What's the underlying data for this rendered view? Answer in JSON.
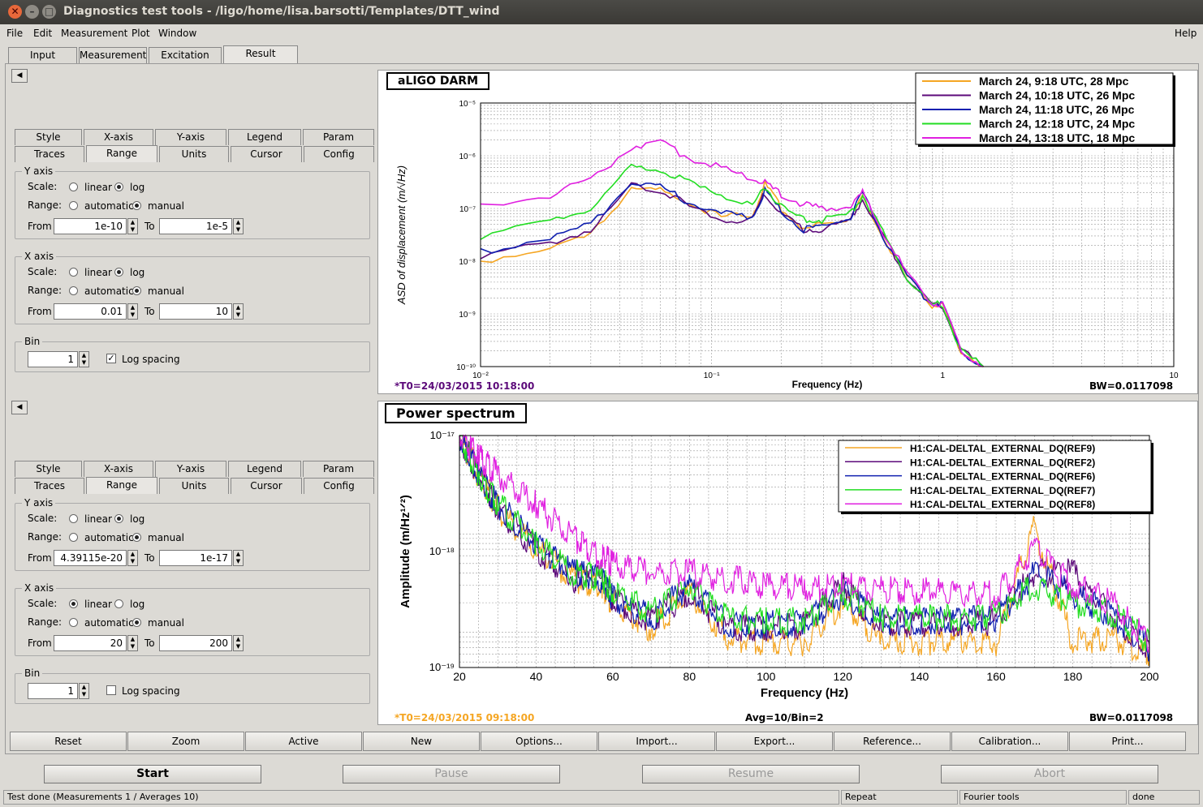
{
  "window": {
    "title": "Diagnostics test tools - /ligo/home/lisa.barsotti/Templates/DTT_wind"
  },
  "menu": [
    "File",
    "Edit",
    "Measurement",
    "Plot",
    "Window"
  ],
  "menu_help": "Help",
  "main_tabs": [
    "Input",
    "Measurement",
    "Excitation",
    "Result"
  ],
  "options_tabs_row1": [
    "Style",
    "X-axis",
    "Y-axis",
    "Legend",
    "Param"
  ],
  "options_tabs_row2": [
    "Traces",
    "Range",
    "Units",
    "Cursor",
    "Config"
  ],
  "labels": {
    "y_axis": "Y axis",
    "x_axis": "X axis",
    "scale": "Scale:",
    "range": "Range:",
    "linear": "linear",
    "log": "log",
    "automatic": "automatic",
    "manual": "manual",
    "from": "From",
    "to": "To",
    "bin": "Bin",
    "log_spacing": "Log spacing"
  },
  "panel1": {
    "y_from": "1e-10",
    "y_to": "1e-5",
    "x_from": "0.01",
    "x_to": "10",
    "bin": "1",
    "y_scale": "log",
    "x_scale": "log",
    "log_spacing": true
  },
  "panel2": {
    "y_from": "4.39115e-20",
    "y_to": "1e-17",
    "x_from": "20",
    "x_to": "200",
    "bin": "1",
    "y_scale": "log",
    "x_scale": "linear",
    "log_spacing": false
  },
  "toolbar": [
    "Reset",
    "Zoom",
    "Active",
    "New",
    "Options...",
    "Import...",
    "Export...",
    "Reference...",
    "Calibration...",
    "Print..."
  ],
  "controls": {
    "start": "Start",
    "pause": "Pause",
    "resume": "Resume",
    "abort": "Abort"
  },
  "status": {
    "message": "Test done (Measurements 1 / Averages 10)",
    "repeat": "Repeat",
    "tool": "Fourier tools",
    "state": "done"
  },
  "plot1": {
    "title": "aLIGO DARM",
    "t0": "*T0=24/03/2015 10:18:00",
    "bw": "BW=0.0117098",
    "ylabel": "ASD of displacement  (m/√Hz)",
    "xlabel": "Frequency (Hz)",
    "yticks": [
      "10⁻⁵",
      "10⁻⁶",
      "10⁻⁷",
      "10⁻⁸",
      "10⁻⁹",
      "10⁻¹⁰"
    ],
    "xticks": [
      "10⁻²",
      "10⁻¹",
      "1",
      "10"
    ],
    "legend": [
      {
        "label": "March 24, 9:18 UTC, 28 Mpc",
        "color": "#f5a623"
      },
      {
        "label": "March 24, 10:18 UTC, 26 Mpc",
        "color": "#5c0a7a"
      },
      {
        "label": "March 24, 11:18 UTC, 26 Mpc",
        "color": "#1020b0"
      },
      {
        "label": "March 24, 12:18 UTC, 24 Mpc",
        "color": "#22dd22"
      },
      {
        "label": "March 24, 13:18 UTC, 18 Mpc",
        "color": "#e020e0"
      }
    ]
  },
  "plot2": {
    "title": "Power spectrum",
    "t0": "*T0=24/03/2015 09:18:00",
    "avg": "Avg=10/Bin=2",
    "bw": "BW=0.0117098",
    "ylabel": "Amplitude (m/Hz¹ᐟ²)",
    "xlabel": "Frequency (Hz)",
    "yticks": [
      "10⁻¹⁷",
      "10⁻¹⁸",
      "10⁻¹⁹"
    ],
    "xticks": [
      "20",
      "40",
      "60",
      "80",
      "100",
      "120",
      "140",
      "160",
      "180",
      "200"
    ],
    "legend": [
      {
        "label": "H1:CAL-DELTAL_EXTERNAL_DQ(REF9)",
        "color": "#f5a623"
      },
      {
        "label": "H1:CAL-DELTAL_EXTERNAL_DQ(REF2)",
        "color": "#5c0a7a"
      },
      {
        "label": "H1:CAL-DELTAL_EXTERNAL_DQ(REF6)",
        "color": "#1020b0"
      },
      {
        "label": "H1:CAL-DELTAL_EXTERNAL_DQ(REF7)",
        "color": "#22dd22"
      },
      {
        "label": "H1:CAL-DELTAL_EXTERNAL_DQ(REF8)",
        "color": "#e020e0"
      }
    ]
  },
  "chart_data": [
    {
      "type": "line",
      "title": "aLIGO DARM",
      "xlabel": "Frequency (Hz)",
      "ylabel": "ASD of displacement (m/√Hz)",
      "xscale": "log",
      "yscale": "log",
      "xlim": [
        0.01,
        10
      ],
      "ylim": [
        1e-10,
        1e-05
      ],
      "grid": true,
      "legend_position": "top-right",
      "x": [
        0.01,
        0.02,
        0.03,
        0.045,
        0.06,
        0.08,
        0.11,
        0.15,
        0.17,
        0.2,
        0.25,
        0.3,
        0.4,
        0.45,
        0.55,
        0.7,
        0.9,
        1.0,
        1.2,
        1.5
      ],
      "series": [
        {
          "name": "March 24, 9:18 UTC, 28 Mpc",
          "values": [
            1e-08,
            1.8e-08,
            3e-08,
            2.6e-07,
            2.2e-07,
            1.2e-07,
            7e-08,
            7e-08,
            3e-07,
            1e-07,
            4e-08,
            5e-08,
            7e-08,
            1.6e-07,
            3e-08,
            5e-09,
            1.5e-09,
            1.5e-09,
            2e-10,
            1e-10
          ]
        },
        {
          "name": "March 24, 10:18 UTC, 26 Mpc",
          "values": [
            1.2e-08,
            2.2e-08,
            4e-08,
            2.7e-07,
            2.3e-07,
            1.1e-07,
            6e-08,
            6e-08,
            2e-07,
            8e-08,
            4e-08,
            4e-08,
            6e-08,
            1.5e-07,
            3e-08,
            5e-09,
            1.5e-09,
            1.3e-09,
            2e-10,
            1e-10
          ]
        },
        {
          "name": "March 24, 11:18 UTC, 26 Mpc",
          "values": [
            1.5e-08,
            2.8e-08,
            5e-08,
            3e-07,
            2.5e-07,
            1.3e-07,
            8e-08,
            7e-08,
            2.2e-07,
            9e-08,
            4e-08,
            4.5e-08,
            7e-08,
            2e-07,
            3e-08,
            5e-09,
            1.5e-09,
            1.5e-09,
            2e-10,
            1e-10
          ]
        },
        {
          "name": "March 24, 12:18 UTC, 24 Mpc",
          "values": [
            3e-08,
            6e-08,
            1e-07,
            6e-07,
            5.5e-07,
            3e-07,
            1.8e-07,
            1.1e-07,
            2.5e-07,
            1.1e-07,
            6e-08,
            6e-08,
            8e-08,
            1.8e-07,
            3.5e-08,
            5e-09,
            1.5e-09,
            1.5e-09,
            2e-10,
            1e-10
          ]
        },
        {
          "name": "March 24, 13:18 UTC, 18 Mpc",
          "values": [
            1.1e-07,
            1.8e-07,
            3.5e-07,
            1.5e-06,
            1.8e-06,
            9e-07,
            6e-07,
            3.5e-07,
            3e-07,
            1.8e-07,
            1.2e-07,
            1e-07,
            1.1e-07,
            2e-07,
            3.5e-08,
            6e-09,
            1.6e-09,
            1.5e-09,
            2e-10,
            1e-10
          ]
        }
      ]
    },
    {
      "type": "line",
      "title": "Power spectrum",
      "xlabel": "Frequency (Hz)",
      "ylabel": "Amplitude (m/Hz¹ᐟ²)",
      "xscale": "linear",
      "yscale": "log",
      "xlim": [
        20,
        200
      ],
      "ylim": [
        4.39115e-20,
        1e-17
      ],
      "grid": true,
      "legend_position": "top-right",
      "x": [
        20,
        25,
        30,
        40,
        50,
        57,
        60,
        70,
        80,
        90,
        100,
        110,
        120,
        130,
        140,
        150,
        160,
        170,
        180,
        190,
        200
      ],
      "series": [
        {
          "name": "H1:CAL-DELTAL_EXTERNAL_DQ(REF9)",
          "values": [
            1e-17,
            4e-18,
            1.8e-18,
            7e-19,
            3.5e-19,
            3e-19,
            2e-19,
            1.1e-19,
            2.5e-19,
            9e-20,
            8e-20,
            8e-20,
            2e-19,
            8e-20,
            8e-20,
            8e-20,
            8e-20,
            1.2e-18,
            8e-20,
            9e-20,
            6e-20
          ]
        },
        {
          "name": "H1:CAL-DELTAL_EXTERNAL_DQ(REF2)",
          "values": [
            1e-17,
            4e-18,
            1.8e-18,
            7e-19,
            3.5e-19,
            3.5e-19,
            2.2e-19,
            1.3e-19,
            2.7e-19,
            1.1e-19,
            1.1e-19,
            1.2e-19,
            3e-19,
            1.2e-19,
            1.2e-19,
            1.2e-19,
            1.3e-19,
            4e-19,
            4e-19,
            1.5e-19,
            7e-20
          ]
        },
        {
          "name": "H1:CAL-DELTAL_EXTERNAL_DQ(REF6)",
          "values": [
            1e-17,
            4e-18,
            2e-18,
            8e-19,
            4e-19,
            3.5e-19,
            2.2e-19,
            1.4e-19,
            3e-19,
            1.2e-19,
            1.2e-19,
            1.2e-19,
            2.5e-19,
            1.3e-19,
            1.3e-19,
            1.3e-19,
            1.4e-19,
            4e-19,
            2.5e-19,
            1.5e-19,
            7e-20
          ]
        },
        {
          "name": "H1:CAL-DELTAL_EXTERNAL_DQ(REF7)",
          "values": [
            1e-17,
            4e-18,
            2e-18,
            8e-19,
            4e-19,
            3.5e-19,
            2.5e-19,
            1.6e-19,
            3e-19,
            1.4e-19,
            1.3e-19,
            1.3e-19,
            2.5e-19,
            1.4e-19,
            1.4e-19,
            1.4e-19,
            1.5e-19,
            3e-19,
            2e-19,
            1.6e-19,
            8e-20
          ]
        },
        {
          "name": "H1:CAL-DELTAL_EXTERNAL_DQ(REF8)",
          "values": [
            1e-17,
            6e-18,
            4e-18,
            2e-18,
            9e-19,
            6e-19,
            5e-19,
            4e-19,
            4e-19,
            3.5e-19,
            3e-19,
            2.8e-19,
            3e-19,
            2.8e-19,
            2.6e-19,
            2.5e-19,
            2.4e-19,
            7e-19,
            3e-19,
            2e-19,
            8e-20
          ]
        }
      ]
    }
  ]
}
